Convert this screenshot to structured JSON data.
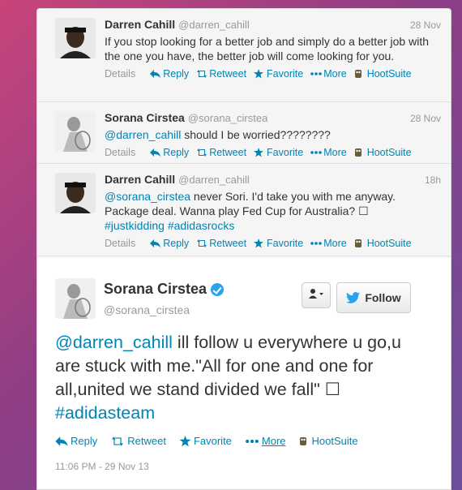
{
  "tweets": [
    {
      "name": "Darren Cahill",
      "handle": "@darren_cahill",
      "time": "28 Nov",
      "text": "If you stop looking for a better job and simply do a better job with the one you have, the better job will come looking for you.",
      "actions": {
        "details": "Details",
        "reply": "Reply",
        "retweet": "Retweet",
        "favorite": "Favorite",
        "more": "More",
        "hootsuite": "HootSuite"
      }
    },
    {
      "name": "Sorana Cirstea",
      "handle": "@sorana_cirstea",
      "time": "28 Nov",
      "mention": "@darren_cahill",
      "text": " should I be worried????????",
      "actions": {
        "details": "Details",
        "reply": "Reply",
        "retweet": "Retweet",
        "favorite": "Favorite",
        "more": "More",
        "hootsuite": "HootSuite"
      }
    },
    {
      "name": "Darren Cahill",
      "handle": "@darren_cahill",
      "time": "18h",
      "mention": "@sorana_cirstea",
      "text": " never Sori. I'd take you with me anyway. Package deal. Wanna play Fed Cup for Australia? ☐",
      "hashtags": "#justkidding #adidasrocks",
      "actions": {
        "details": "Details",
        "reply": "Reply",
        "retweet": "Retweet",
        "favorite": "Favorite",
        "more": "More",
        "hootsuite": "HootSuite"
      }
    }
  ],
  "focused": {
    "name": "Sorana Cirstea",
    "handle": "@sorana_cirstea",
    "follow_label": "Follow",
    "mention": "@darren_cahill",
    "text": " ill follow u everywhere u go,u are stuck with me.\"All for one and one for all,united we stand divided we fall\" ☐",
    "hashtag": "#adidasteam",
    "actions": {
      "reply": "Reply",
      "retweet": "Retweet",
      "favorite": "Favorite",
      "more": "More",
      "hootsuite": "HootSuite"
    },
    "timestamp": "11:06 PM - 29 Nov 13"
  },
  "colors": {
    "link": "#0084b4",
    "verified": "#2aa3ef",
    "bird": "#2aa3ef"
  }
}
